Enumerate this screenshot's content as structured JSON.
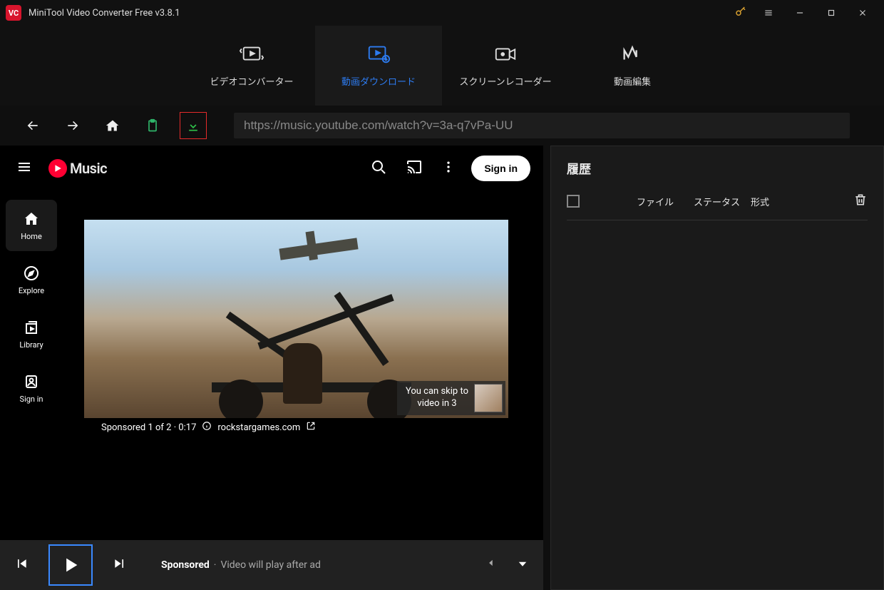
{
  "app": {
    "title": "MiniTool Video Converter Free v3.8.1"
  },
  "tabs": {
    "converter": "ビデオコンバーター",
    "download": "動画ダウンロード",
    "recorder": "スクリーンレコーダー",
    "editor": "動画編集"
  },
  "url": "https://music.youtube.com/watch?v=3a-q7vPa-UU",
  "yt": {
    "logo": "Music",
    "signin": "Sign in",
    "nav": {
      "home": "Home",
      "explore": "Explore",
      "library": "Library",
      "signin": "Sign in"
    },
    "skip": {
      "line1": "You can skip to",
      "line2": "video in 3"
    },
    "ad_meta": {
      "count": "Sponsored 1 of 2 · 0:17",
      "domain": "rockstargames.com"
    }
  },
  "player": {
    "sponsored": "Sponsored",
    "sub": "Video will play after ad"
  },
  "history": {
    "title": "履歴",
    "cols": {
      "file": "ファイル",
      "status": "ステータス",
      "format": "形式"
    }
  }
}
